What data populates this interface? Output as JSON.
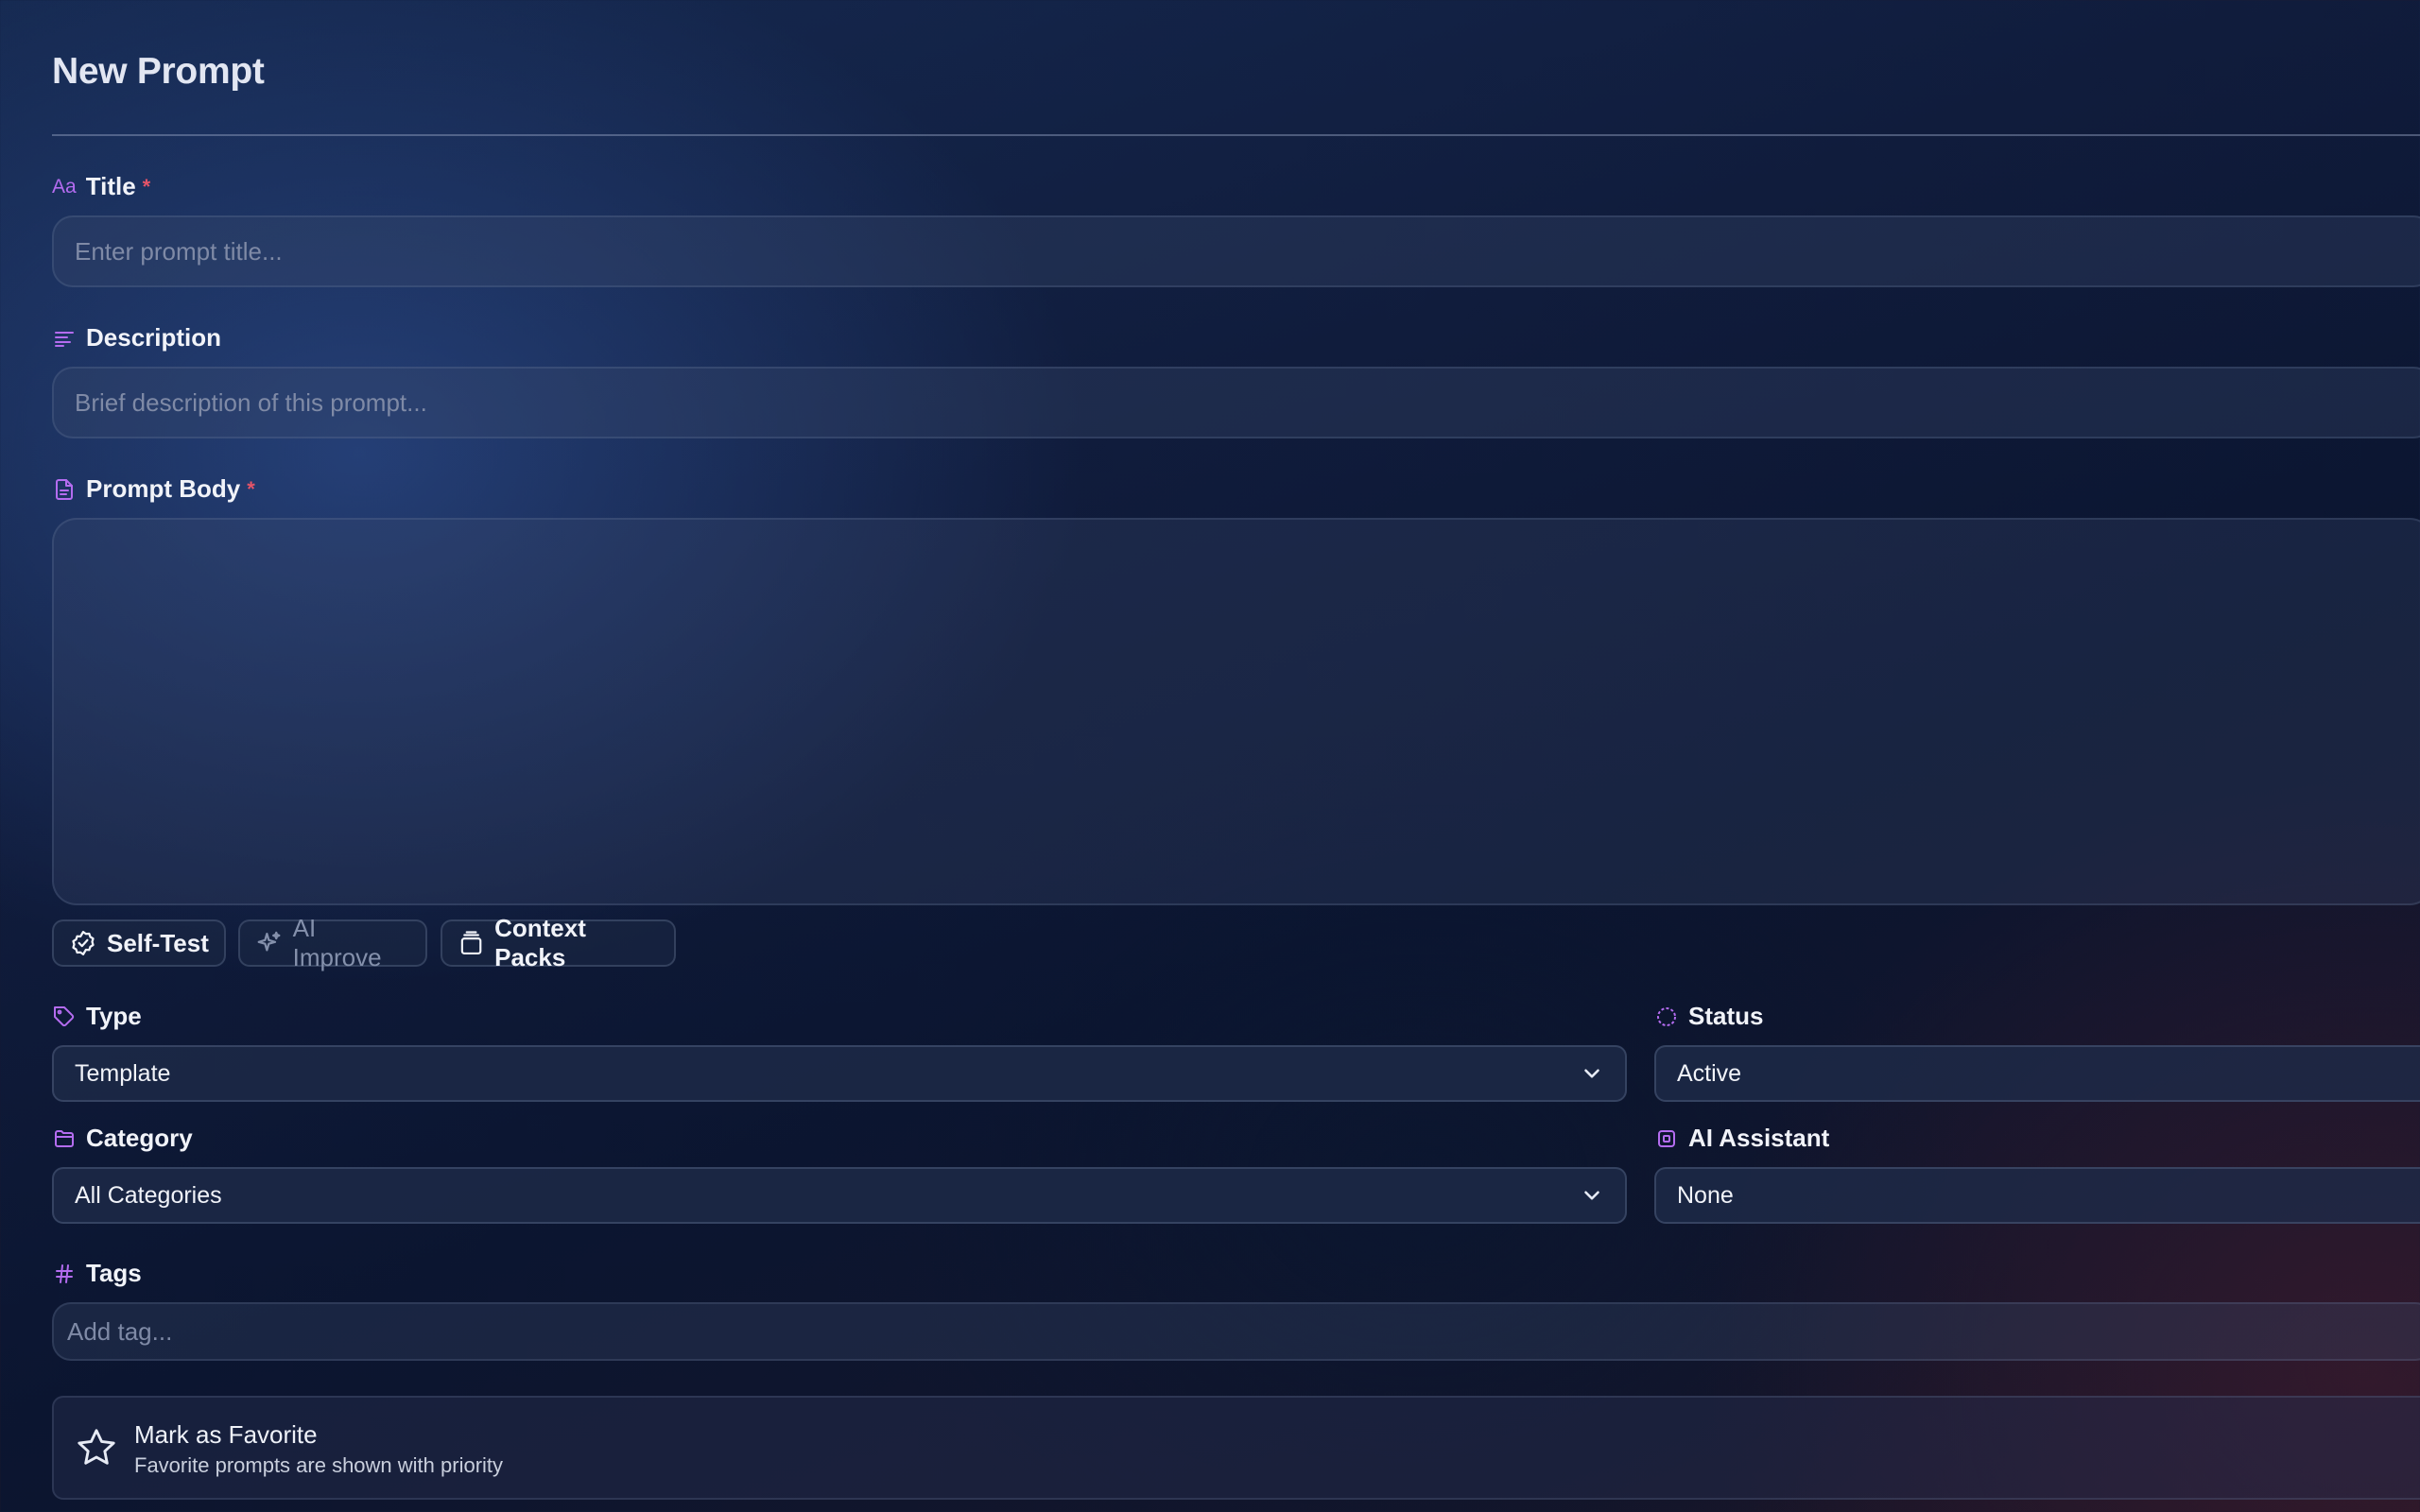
{
  "page": {
    "title": "New Prompt"
  },
  "title_field": {
    "label": "Title",
    "icon_text": "Aa",
    "required_mark": "*",
    "placeholder": "Enter prompt title..."
  },
  "description_field": {
    "label": "Description",
    "placeholder": "Brief description of this prompt..."
  },
  "body_field": {
    "label": "Prompt Body",
    "required_mark": "*",
    "value": ""
  },
  "tools": {
    "self_test": "Self-Test",
    "ai_improve": "AI Improve",
    "context_packs": "Context Packs"
  },
  "type_field": {
    "label": "Type",
    "value": "Template"
  },
  "status_field": {
    "label": "Status",
    "value": "Active"
  },
  "category_field": {
    "label": "Category",
    "value": "All Categories"
  },
  "assistant_field": {
    "label": "AI Assistant",
    "value": "None"
  },
  "tags_field": {
    "label": "Tags",
    "icon_text": "#",
    "placeholder": "Add tag..."
  },
  "favorite": {
    "title": "Mark as Favorite",
    "subtitle": "Favorite prompts are shown with priority"
  },
  "colors": {
    "accent": "#b46cf0",
    "required": "#e45468",
    "text": "#f1f3f9",
    "placeholder": "#7f8aa6"
  },
  "icons": [
    "text-icon",
    "lines-icon",
    "document-icon",
    "badge-check-icon",
    "sparkle-icon",
    "layers-icon",
    "tag-icon",
    "status-circle-icon",
    "folder-icon",
    "chip-icon",
    "hash-icon",
    "star-icon",
    "chevron-down-icon"
  ]
}
